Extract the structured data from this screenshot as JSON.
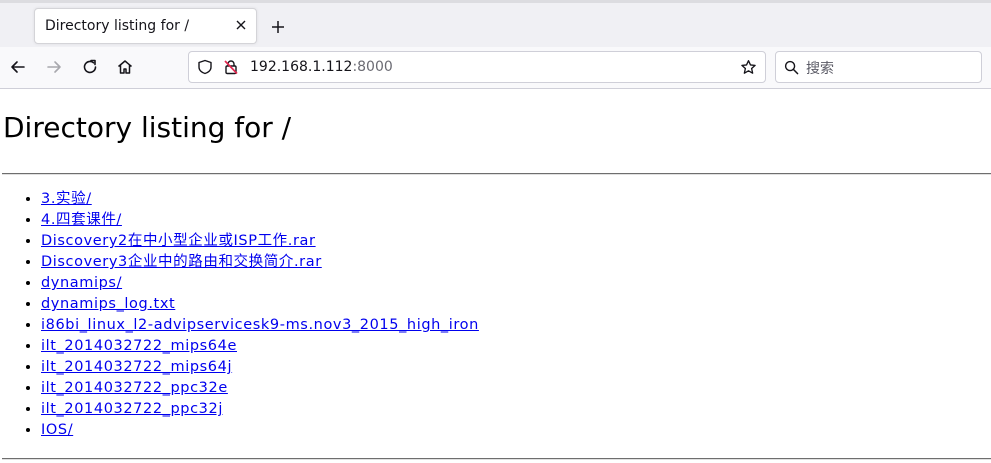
{
  "browser": {
    "tab": {
      "title": "Directory listing for /"
    },
    "url": {
      "host": "192.168.1.112",
      "port": ":8000"
    },
    "search": {
      "placeholder": "搜索"
    },
    "icons": {
      "tab_close": "close-icon",
      "new_tab": "plus-icon",
      "back": "back-arrow-icon",
      "forward": "forward-arrow-icon",
      "reload": "reload-icon",
      "home": "home-icon",
      "site_info": "shield-icon",
      "insecure": "insecure-lock-icon",
      "bookmark": "star-icon",
      "search": "search-icon"
    }
  },
  "page": {
    "title": "Directory listing for /",
    "link_color": "#0000ee",
    "entries": [
      "3.实验/",
      "4.四套课件/",
      "Discovery2在中小型企业或ISP工作.rar",
      "Discovery3企业中的路由和交换简介.rar",
      "dynamips/",
      "dynamips_log.txt",
      "i86bi_linux_l2-advipservicesk9-ms.nov3_2015_high_iron",
      "ilt_2014032722_mips64e",
      "ilt_2014032722_mips64j",
      "ilt_2014032722_ppc32e",
      "ilt_2014032722_ppc32j",
      "IOS/"
    ]
  }
}
